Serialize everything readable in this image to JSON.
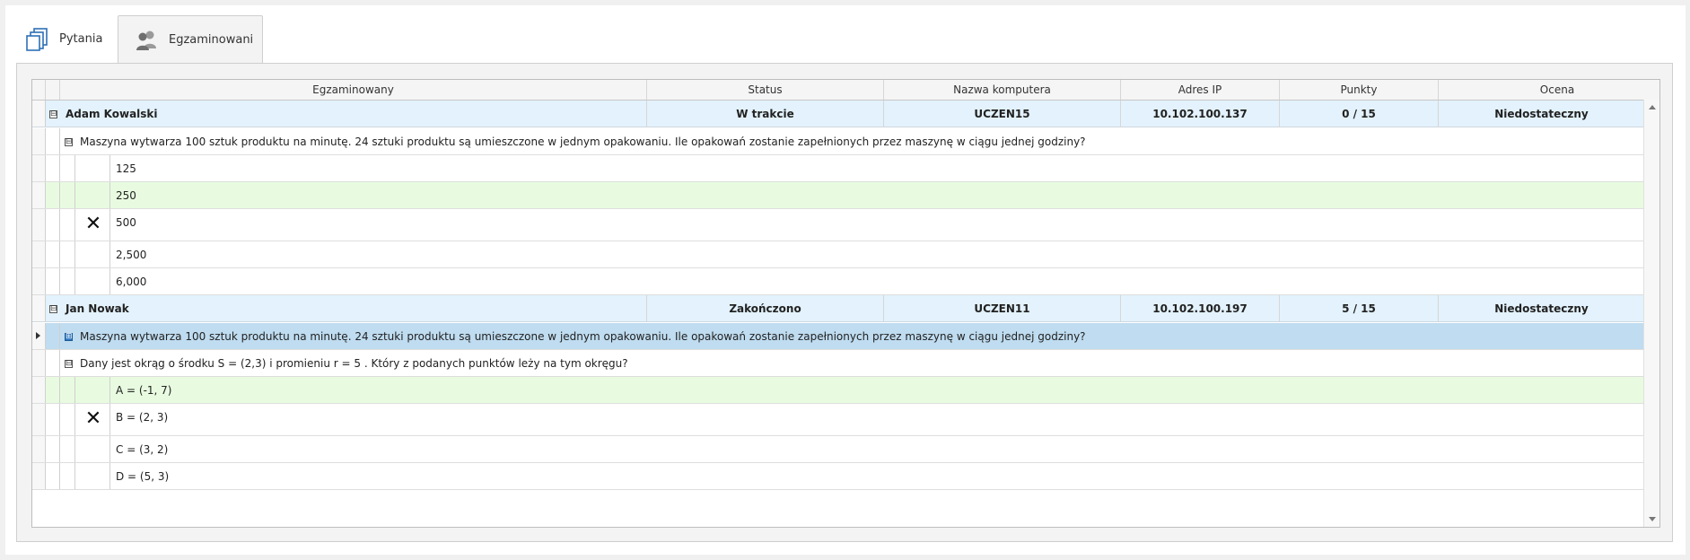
{
  "tabs": [
    {
      "label": "Pytania",
      "icon": "copy-icon"
    },
    {
      "label": "Egzaminowani",
      "icon": "users-icon"
    }
  ],
  "grid": {
    "columns": [
      "Egzaminowany",
      "Status",
      "Nazwa komputera",
      "Adres IP",
      "Punkty",
      "Ocena"
    ],
    "groups": [
      {
        "name": "Adam Kowalski",
        "status": "W trakcie",
        "computer": "UCZEN15",
        "ip": "10.102.100.137",
        "points": "0 / 15",
        "grade": "Niedostateczny",
        "question": "Maszyna wytwarza 100 sztuk produktu na minutę. 24 sztuki produktu są umieszczone w jednym opakowaniu. Ile opakowań zostanie zapełnionych przez maszynę w ciągu jednej godziny?",
        "answers": [
          "125",
          "250",
          "500",
          "2,500",
          "6,000"
        ]
      },
      {
        "name": "Jan Nowak",
        "status": "Zakończono",
        "computer": "UCZEN11",
        "ip": "10.102.100.197",
        "points": "5 / 15",
        "grade": "Niedostateczny",
        "question1": "Maszyna wytwarza 100 sztuk produktu na minutę. 24 sztuki produktu są umieszczone w jednym opakowaniu. Ile opakowań zostanie zapełnionych przez maszynę w ciągu jednej godziny?",
        "question2": "Dany jest okrąg o środku S = (2,3) i promieniu r = 5 . Który z podanych punktów leży na tym okręgu?",
        "answers": [
          "A = (-1, 7)",
          "B = (2, 3)",
          "C = (3, 2)",
          "D = (5, 3)"
        ]
      }
    ],
    "expand_glyph": "⊟",
    "collapse_glyph": "⊞",
    "wrong_mark": "✕"
  },
  "colors": {
    "group_bg": "#e3f2fc",
    "correct_bg": "#e8fbe0",
    "selected_bg": "#bfdcf0"
  }
}
